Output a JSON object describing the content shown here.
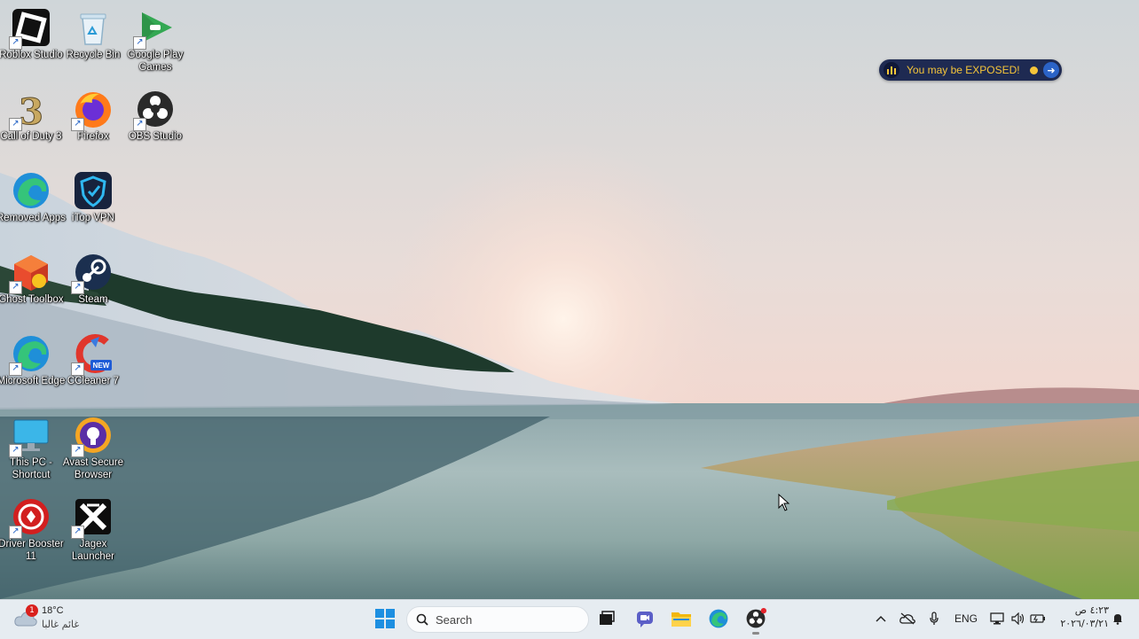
{
  "desktop": {
    "icons": [
      {
        "label": "Roblox Studio",
        "icon": "roblox-studio-icon"
      },
      {
        "label": "Recycle Bin",
        "icon": "recycle-bin-icon"
      },
      {
        "label": "Google Play Games",
        "icon": "google-play-games-icon"
      },
      {
        "label": "Call of Duty 3",
        "icon": "call-of-duty-icon"
      },
      {
        "label": "Firefox",
        "icon": "firefox-icon"
      },
      {
        "label": "OBS Studio",
        "icon": "obs-studio-icon"
      },
      {
        "label": "Removed Apps",
        "icon": "edge-icon"
      },
      {
        "label": "iTop VPN",
        "icon": "itop-vpn-icon"
      },
      {
        "label": "Ghost Toolbox",
        "icon": "ghost-toolbox-icon"
      },
      {
        "label": "Steam",
        "icon": "steam-icon"
      },
      {
        "label": "Microsoft Edge",
        "icon": "edge-icon"
      },
      {
        "label": "CCleaner 7",
        "icon": "ccleaner-icon",
        "badge": "NEW"
      },
      {
        "label": "This PC - Shortcut",
        "icon": "monitor-icon"
      },
      {
        "label": "Avast Secure Browser",
        "icon": "avast-browser-icon"
      },
      {
        "label": "Driver Booster 11",
        "icon": "driver-booster-icon"
      },
      {
        "label": "Jagex Launcher",
        "icon": "jagex-icon"
      }
    ]
  },
  "exposed_widget": {
    "text": "You may be EXPOSED!",
    "text_color": "#f5c53a",
    "background": "#1e2a52"
  },
  "taskbar": {
    "weather": {
      "temperature": "18°C",
      "condition": "غائم غالبا",
      "badge_count": "1"
    },
    "search": {
      "placeholder": "Search"
    },
    "pinned": [
      "start-icon",
      "task-view-icon",
      "meet-icon",
      "file-explorer-icon",
      "edge-icon",
      "obs-studio-icon"
    ],
    "tray": {
      "language": "ENG",
      "time": "٤:٢٣ ص",
      "date": "٢٠٢٦/٠٣/٢١"
    }
  }
}
